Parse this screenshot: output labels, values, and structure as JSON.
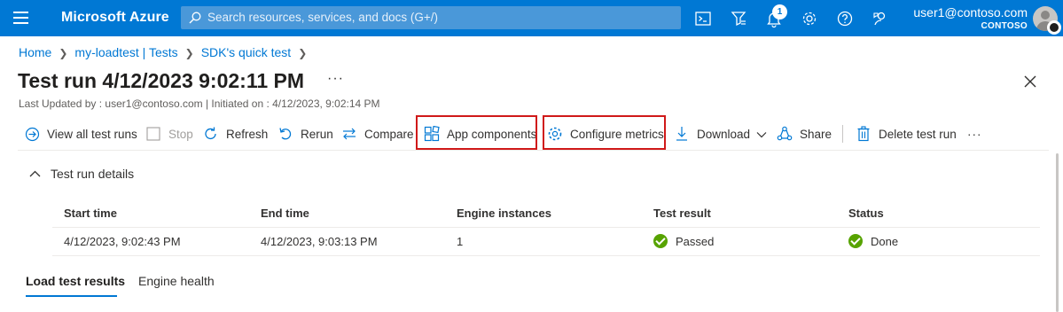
{
  "topbar": {
    "brand": "Microsoft Azure",
    "search_placeholder": "Search resources, services, and docs (G+/)",
    "notification_count": "1",
    "account_email": "user1@contoso.com",
    "account_tenant": "CONTOSO",
    "icons": [
      "cloud-shell-icon",
      "directory-filter-icon",
      "notifications-icon",
      "settings-icon",
      "help-icon",
      "feedback-icon"
    ]
  },
  "breadcrumb": [
    "Home",
    "my-loadtest | Tests",
    "SDK's quick test"
  ],
  "page": {
    "title": "Test run 4/12/2023 9:02:11 PM",
    "more": "···",
    "subtitle": "Last Updated by : user1@contoso.com | Initiated on : 4/12/2023, 9:02:14 PM"
  },
  "toolbar": {
    "view_all": "View all test runs",
    "stop": "Stop",
    "refresh": "Refresh",
    "rerun": "Rerun",
    "compare": "Compare",
    "app_components": "App components",
    "configure_metrics": "Configure metrics",
    "download": "Download",
    "share": "Share",
    "delete": "Delete test run",
    "more": "···"
  },
  "details": {
    "section_title": "Test run details",
    "columns": [
      "Start time",
      "End time",
      "Engine instances",
      "Test result",
      "Status"
    ],
    "row": {
      "start_time": "4/12/2023, 9:02:43 PM",
      "end_time": "4/12/2023, 9:03:13 PM",
      "engine_instances": "1",
      "test_result": "Passed",
      "status": "Done"
    }
  },
  "tabs": [
    "Load test results",
    "Engine health"
  ],
  "colors": {
    "azure_blue": "#0078d4",
    "highlight_red": "#d01919",
    "success_green": "#57a300"
  }
}
